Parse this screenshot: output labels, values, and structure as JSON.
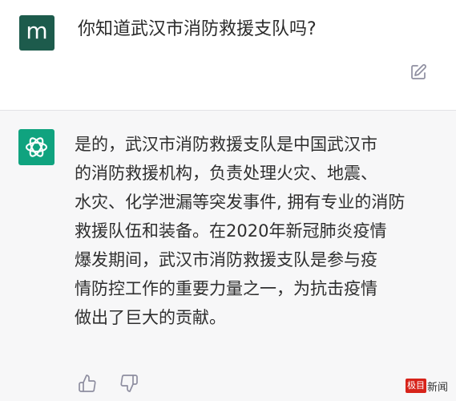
{
  "user_message": {
    "avatar_letter": "m",
    "text": "你知道武汉市消防救援支队吗?"
  },
  "assistant_message": {
    "lines": [
      "是的，武汉市消防救援支队是中国武汉市",
      "的消防救援机构，负责处理火灾、地震、",
      "水灾、化学泄漏等突发事件, 拥有专业的消防",
      "救援队伍和装备。在2020年新冠肺炎疫情",
      "爆发期间，武汉市消防救援支队是参与疫",
      "情防控工作的重要力量之一，为抗击疫情",
      "做出了巨大的贡献。"
    ]
  },
  "icons": {
    "edit": "edit-icon",
    "openai": "openai-logo-icon",
    "thumbs_up": "thumbs-up-icon",
    "thumbs_down": "thumbs-down-icon"
  },
  "colors": {
    "user_avatar": "#1d5b4c",
    "assistant_avatar": "#10a37f",
    "assistant_background": "#f7f7f8",
    "watermark_red": "#d7231a"
  },
  "watermark": {
    "logo_text": "极目",
    "text": "新闻"
  }
}
